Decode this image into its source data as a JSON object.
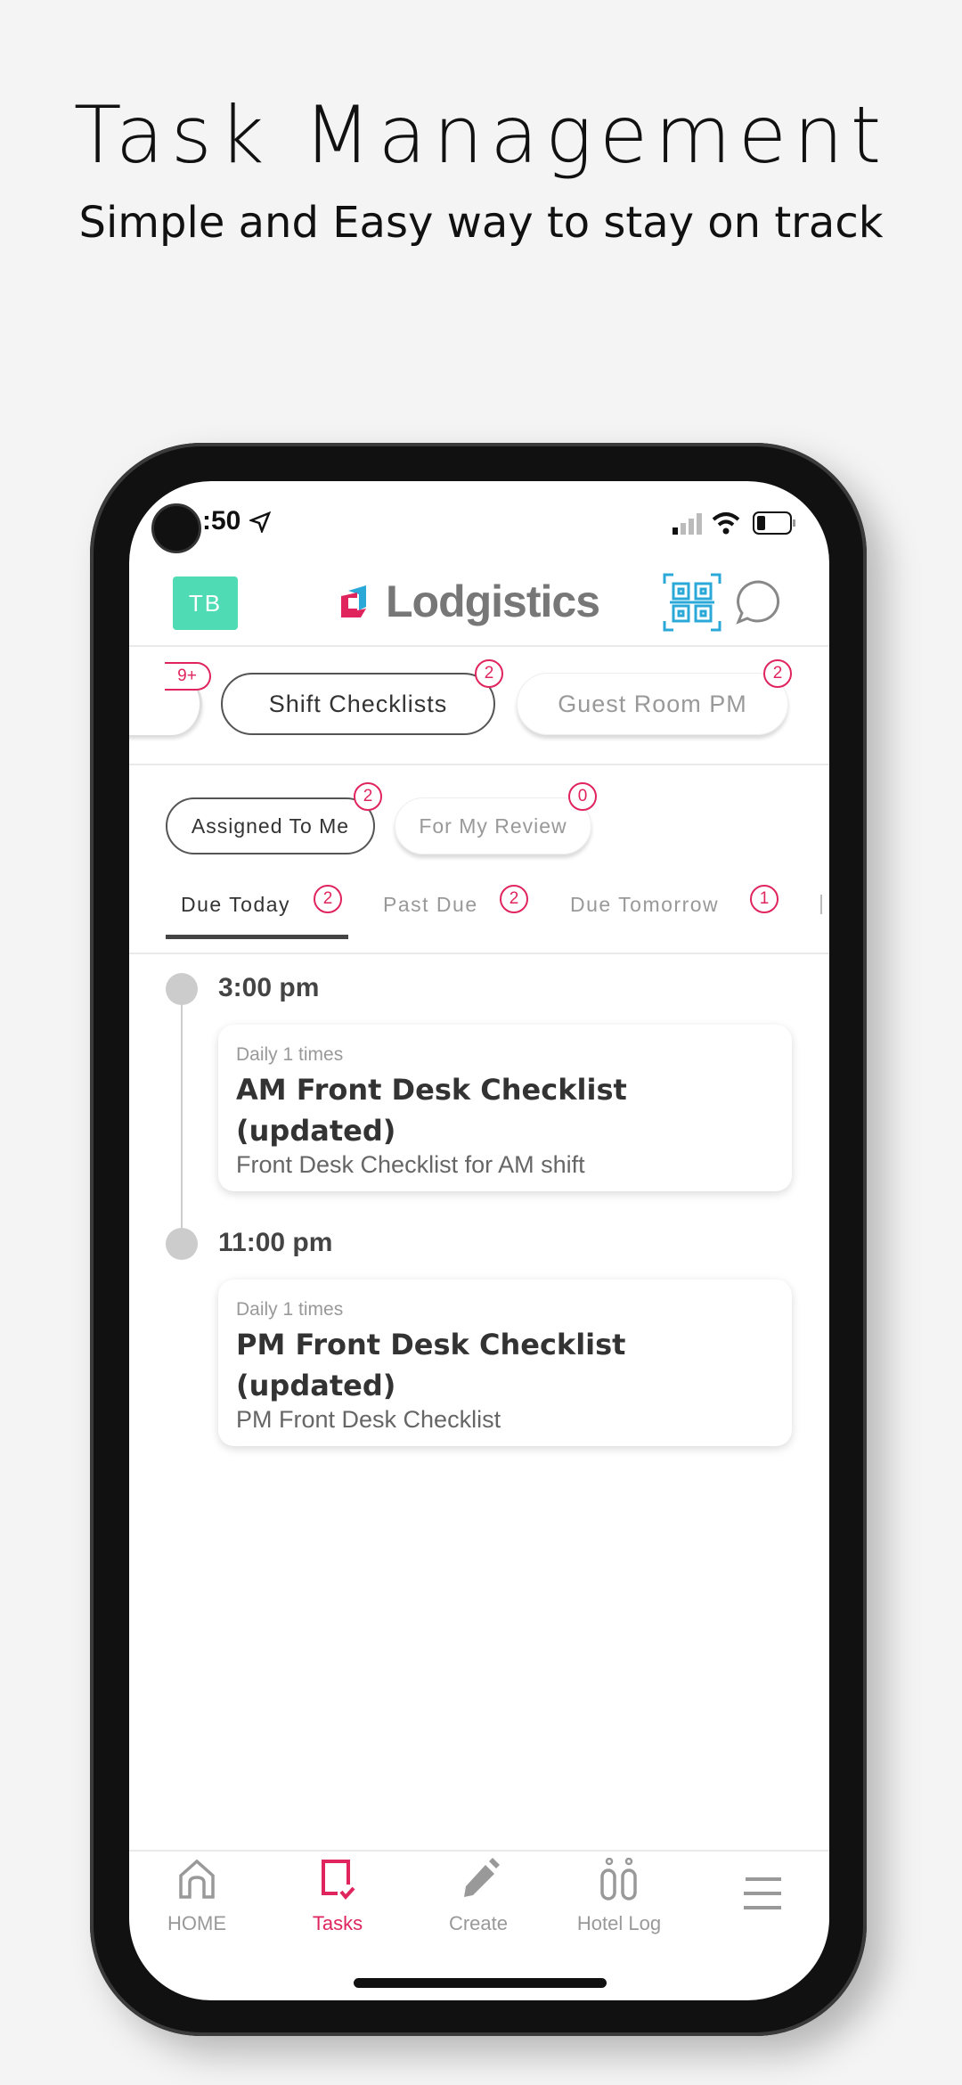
{
  "page": {
    "title": "Task Management",
    "subtitle": "Simple and Easy way to stay on track"
  },
  "status_bar": {
    "time": ":50"
  },
  "header": {
    "avatar_initials": "TB",
    "avatar_color": "#4fdcb4",
    "logo_text": "Lodgistics",
    "qr_icon": "qr-scan-icon",
    "chat_icon": "chat-bubble-icon"
  },
  "categories": [
    {
      "label": "",
      "badge": "9+"
    },
    {
      "label": "Shift Checklists",
      "badge": "2",
      "active": true
    },
    {
      "label": "Guest Room PM",
      "badge": "2"
    }
  ],
  "filters": [
    {
      "label": "Assigned To Me",
      "badge": "2",
      "active": true
    },
    {
      "label": "For My Review",
      "badge": "0"
    }
  ],
  "tabs": [
    {
      "label": "Due Today",
      "badge": "2",
      "active": true
    },
    {
      "label": "Past Due",
      "badge": "2"
    },
    {
      "label": "Due Tomorrow",
      "badge": "1"
    }
  ],
  "tasks": [
    {
      "time": "3:00 pm",
      "frequency": "Daily 1 times",
      "title_line1": "AM Front Desk Checklist",
      "title_line2": "(updated)",
      "description": "Front Desk Checklist for AM shift"
    },
    {
      "time": "11:00 pm",
      "frequency": "Daily 1 times",
      "title_line1": "PM Front Desk Checklist",
      "title_line2": "(updated)",
      "description": "PM Front Desk Checklist"
    }
  ],
  "bottom_nav": [
    {
      "label": "HOME",
      "icon": "home-icon"
    },
    {
      "label": "Tasks",
      "icon": "tasks-icon",
      "active": true
    },
    {
      "label": "Create",
      "icon": "pencil-icon"
    },
    {
      "label": "Hotel Log",
      "icon": "hotel-log-icon"
    },
    {
      "label": "",
      "icon": "menu-icon"
    }
  ],
  "colors": {
    "accent": "#e0245e",
    "qr": "#2aa8d8"
  }
}
